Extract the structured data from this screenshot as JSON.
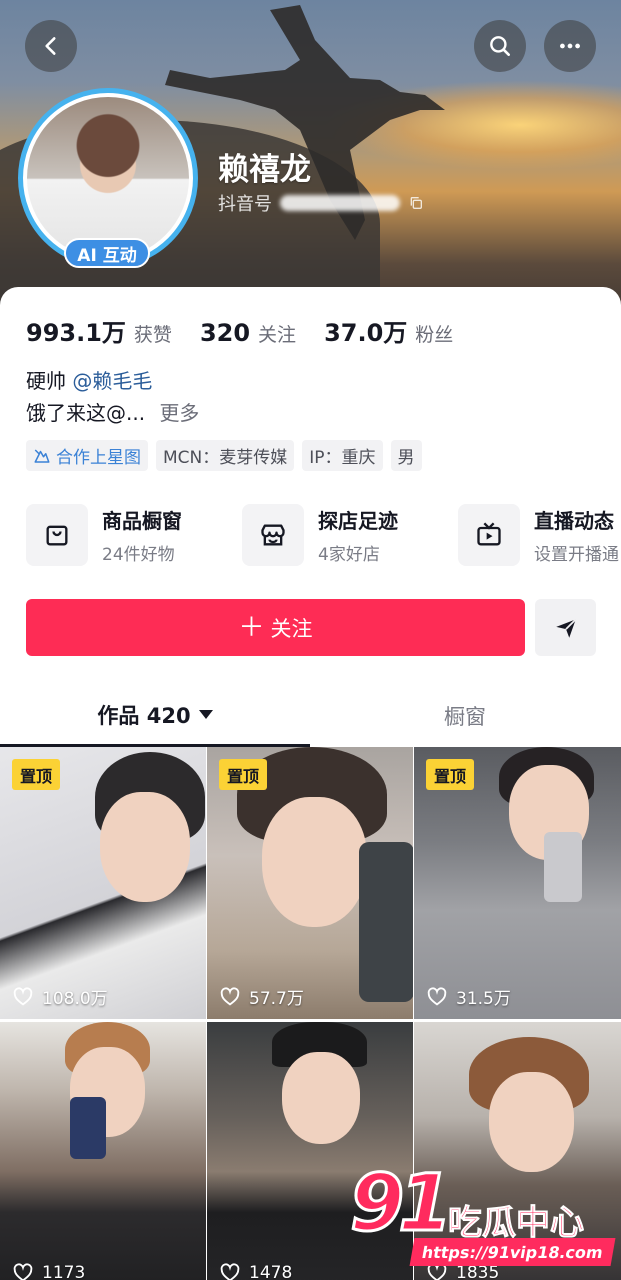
{
  "profile": {
    "nickname": "赖禧龙",
    "douyin_id_label": "抖音号",
    "ai_badge": "AI 互动"
  },
  "stats": [
    {
      "value": "993.1万",
      "label": "获赞"
    },
    {
      "value": "320",
      "label": "关注"
    },
    {
      "value": "37.0万",
      "label": "粉丝"
    }
  ],
  "bio": {
    "line1_prefix": "硬帅",
    "line1_mention": "@赖毛毛",
    "line2_text": "饿了来这@...",
    "more": "更多"
  },
  "tags": [
    {
      "label": "合作上星图",
      "icon": "star-map-icon"
    },
    {
      "label": "MCN：麦芽传媒"
    },
    {
      "label": "IP：重庆"
    },
    {
      "label": "男"
    }
  ],
  "services": [
    {
      "title": "商品橱窗",
      "subtitle": "24件好物",
      "icon": "shopping-bag-icon"
    },
    {
      "title": "探店足迹",
      "subtitle": "4家好店",
      "icon": "store-icon"
    },
    {
      "title": "直播动态",
      "subtitle": "设置开播通",
      "icon": "live-tv-icon"
    }
  ],
  "actions": {
    "follow_label": "关注",
    "follow_color": "#fe2c55"
  },
  "tabs": [
    {
      "label": "作品 420",
      "active": true
    },
    {
      "label": "橱窗",
      "active": false
    }
  ],
  "videos": [
    {
      "pinned": "置顶",
      "likes": "108.0万"
    },
    {
      "pinned": "置顶",
      "likes": "57.7万"
    },
    {
      "pinned": "置顶",
      "likes": "31.5万"
    },
    {
      "pinned": "",
      "likes": "1173"
    },
    {
      "pinned": "",
      "likes": "1478"
    },
    {
      "pinned": "",
      "likes": "1835"
    }
  ],
  "watermark": {
    "number": "91",
    "text": "吃瓜中心",
    "url": "https://91vip18.com"
  }
}
